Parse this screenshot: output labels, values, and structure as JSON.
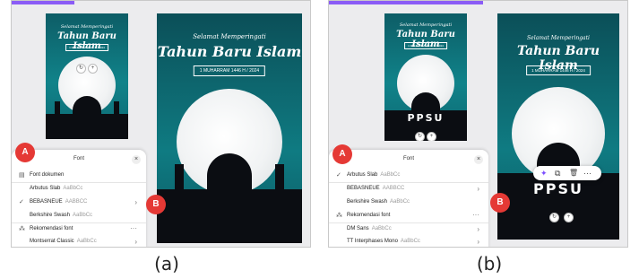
{
  "captions": {
    "a": "(a)",
    "b": "(b)"
  },
  "markers": {
    "a": "A",
    "b": "B"
  },
  "poster": {
    "greeting": "Selamat Memperingati",
    "title": "Tahun Baru Islam",
    "date": "1 MUHARRAM 1446 H / 2024",
    "thumb_date": "1 MUHARRAM 1446 H / 2024"
  },
  "logo_text": "PPSU",
  "font_sheet": {
    "title": "Font",
    "close": "×",
    "rows_a": [
      {
        "icon": "▤",
        "label": "Font dokumen",
        "sample": "",
        "chev": ""
      },
      {
        "icon": "",
        "label": "Arbutus Slab",
        "sample": "AaBbCc",
        "chev": ""
      },
      {
        "icon": "✓",
        "label": "BEBASNEUE",
        "sample": "AABBCC",
        "chev": "›"
      },
      {
        "icon": "",
        "label": "Berkshire Swash",
        "sample": "AaBbCc",
        "chev": ""
      },
      {
        "icon": "⁂",
        "label": "Rekomendasi font",
        "sample": "",
        "chev": "···"
      },
      {
        "icon": "",
        "label": "Montserrat Classic",
        "sample": "AaBbCc",
        "chev": "›"
      }
    ],
    "rows_b": [
      {
        "icon": "✓",
        "label": "Arbutus Slab",
        "sample": "AaBbCc",
        "chev": ""
      },
      {
        "icon": "",
        "label": "BEBASNEUE",
        "sample": "AABBCC",
        "chev": "›"
      },
      {
        "icon": "",
        "label": "Berkshire Swash",
        "sample": "AaBbCc",
        "chev": ""
      },
      {
        "icon": "⁂",
        "label": "Rekomendasi font",
        "sample": "",
        "chev": "···"
      },
      {
        "icon": "",
        "label": "DM Sans",
        "sample": "AaBbCc",
        "chev": "›"
      },
      {
        "icon": "",
        "label": "TT Interphases Mono",
        "sample": "AaBbCc",
        "chev": "›"
      }
    ]
  },
  "toolbar": {
    "sparkle": "✦",
    "copy": "⧉",
    "delete": "🗑",
    "more": "···"
  },
  "canvas_controls": {
    "rotate": "↻",
    "add": "+"
  },
  "colors": {
    "accent": "#8b5cf6",
    "marker": "#e53935",
    "poster_top": "#0b4f58",
    "poster_mid": "#0f7b82"
  }
}
